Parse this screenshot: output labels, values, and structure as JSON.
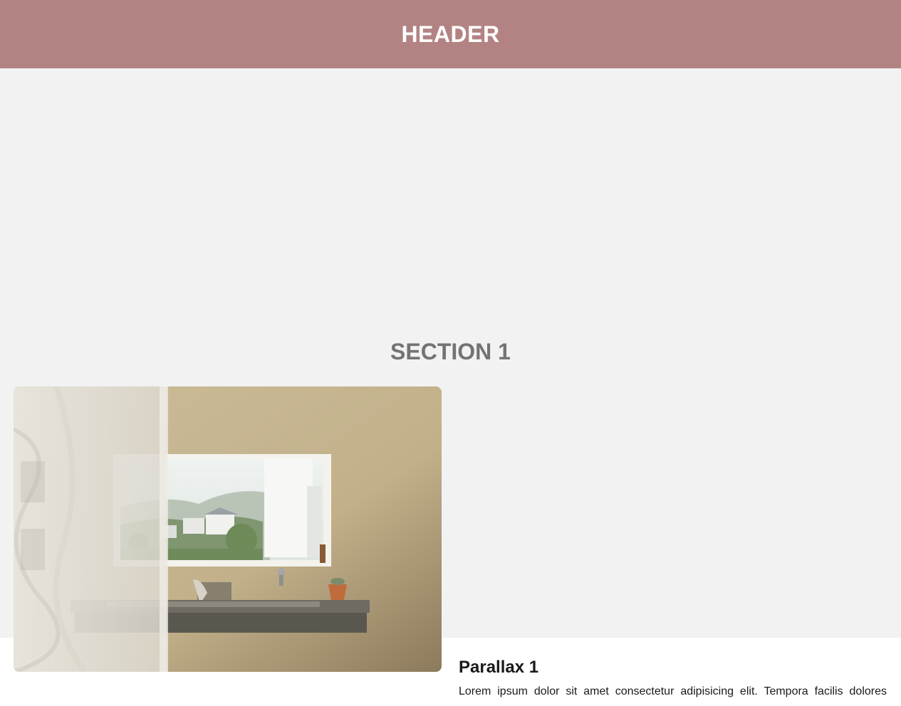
{
  "header": {
    "title": "HEADER"
  },
  "section": {
    "title": "SECTION 1"
  },
  "parallax": {
    "image_alt": "bathroom-sink-window-photo",
    "heading": "Parallax 1",
    "body": "Lorem ipsum dolor sit amet consectetur adipisicing elit. Tempora facilis dolores"
  },
  "colors": {
    "header_bg": "#b38383",
    "section_bg": "#f2f2f2",
    "section_title": "#737373",
    "text": "#1a1a1a"
  }
}
